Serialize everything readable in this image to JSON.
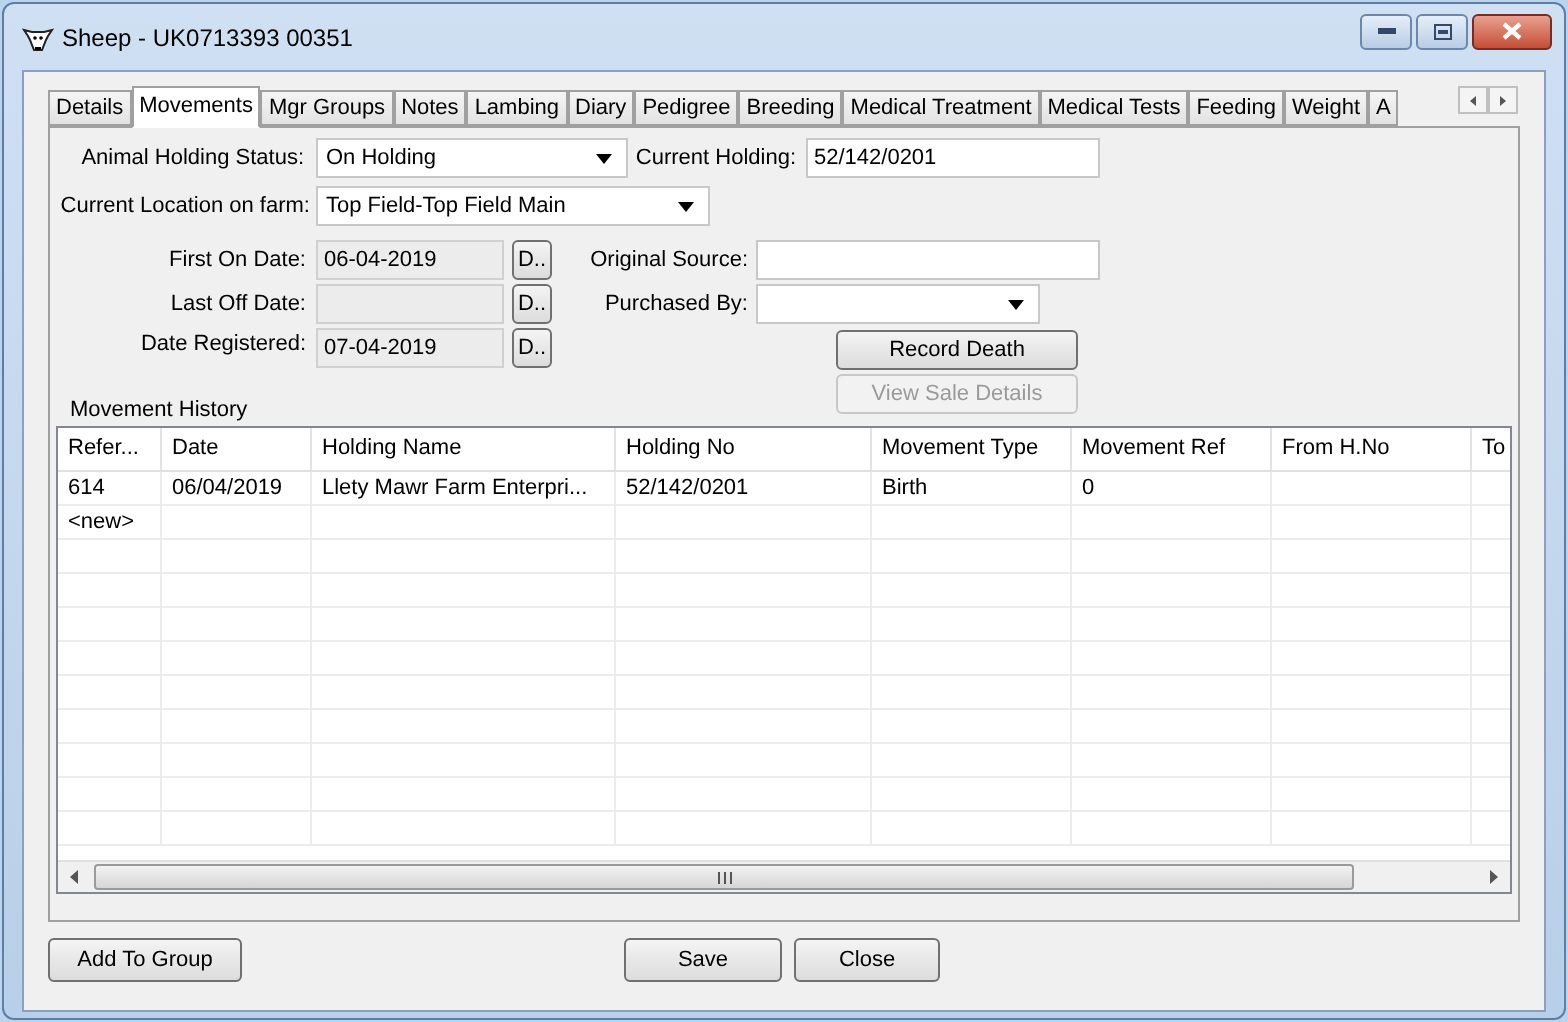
{
  "window": {
    "title": "Sheep - UK0713393 00351"
  },
  "tabs": [
    {
      "label": "Details",
      "selected": false
    },
    {
      "label": "Movements",
      "selected": true
    },
    {
      "label": "Mgr Groups",
      "selected": false
    },
    {
      "label": "Notes",
      "selected": false
    },
    {
      "label": "Lambing",
      "selected": false
    },
    {
      "label": "Diary",
      "selected": false
    },
    {
      "label": "Pedigree",
      "selected": false
    },
    {
      "label": "Breeding",
      "selected": false
    },
    {
      "label": "Medical Treatment",
      "selected": false
    },
    {
      "label": "Medical Tests",
      "selected": false
    },
    {
      "label": "Feeding",
      "selected": false
    },
    {
      "label": "Weight",
      "selected": false
    },
    {
      "label": "A",
      "selected": false
    }
  ],
  "form": {
    "animal_holding_status": {
      "label": "Animal Holding Status:",
      "value": "On Holding"
    },
    "current_holding": {
      "label": "Current Holding:",
      "value": "52/142/0201"
    },
    "current_location": {
      "label": "Current Location on farm:",
      "value": "Top Field-Top Field Main"
    },
    "first_on_date": {
      "label": "First On Date:",
      "value": "06-04-2019",
      "button": "D.."
    },
    "last_off_date": {
      "label": "Last Off Date:",
      "button": "D.."
    },
    "date_registered": {
      "label": "Date Registered:",
      "value": "07-04-2019",
      "button": "D.."
    },
    "original_source": {
      "label": "Original Source:"
    },
    "purchased_by": {
      "label": "Purchased By:"
    },
    "record_death": {
      "label": "Record Death",
      "disabled": false
    },
    "view_sale_details": {
      "label": "View Sale Details",
      "disabled": true
    }
  },
  "movement_history": {
    "title": "Movement History",
    "columns": [
      "Refer...",
      "Date",
      "Holding Name",
      "Holding No",
      "Movement Type",
      "Movement Ref",
      "From H.No",
      "To"
    ],
    "rows": [
      [
        "614",
        "06/04/2019",
        "Llety Mawr Farm Enterpri...",
        "52/142/0201",
        "Birth",
        "0",
        "",
        ""
      ],
      [
        "<new>",
        "",
        "",
        "",
        "",
        "",
        "",
        ""
      ]
    ]
  },
  "buttons": {
    "add_to_group": "Add To Group",
    "save": "Save",
    "close": "Close"
  }
}
